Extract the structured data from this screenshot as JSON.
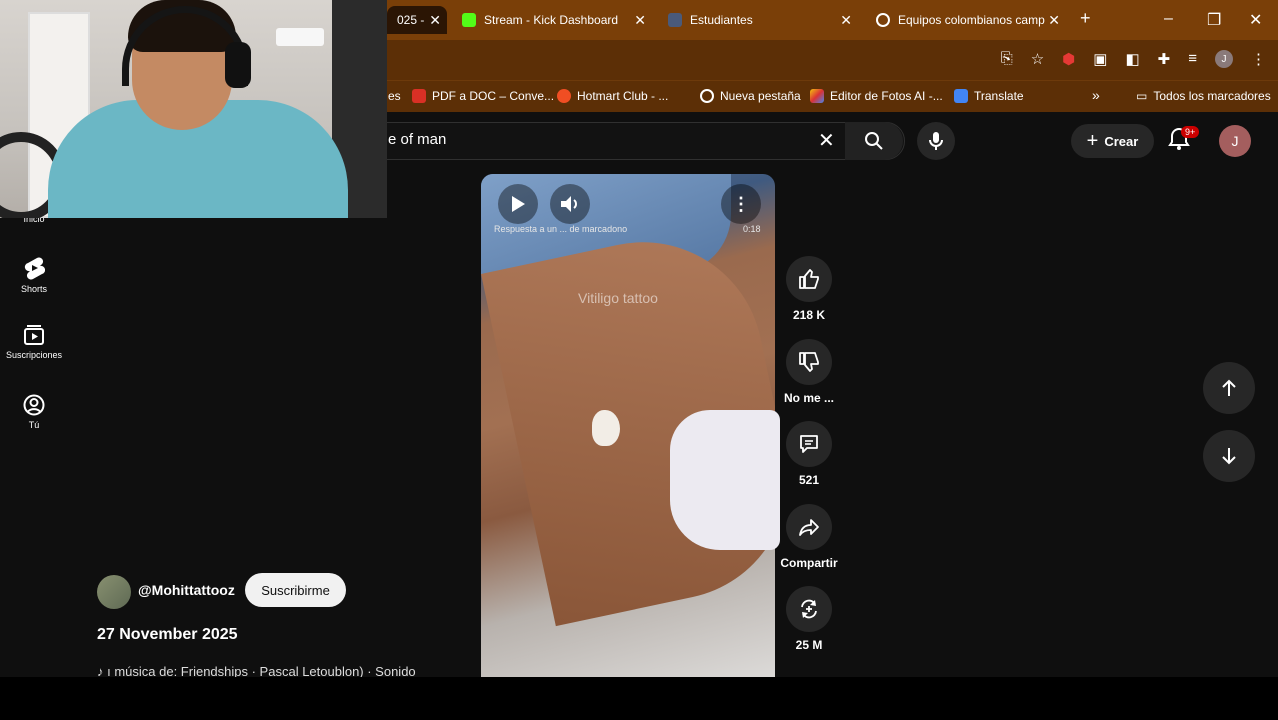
{
  "browser": {
    "tabs": [
      {
        "title": "025 -",
        "active": true
      },
      {
        "title": "Stream - Kick Dashboard",
        "active": false
      },
      {
        "title": "Estudiantes",
        "active": false
      },
      {
        "title": "Equipos colombianos camp",
        "active": false
      }
    ],
    "new_tab": "+",
    "bookmarks": [
      "es",
      "PDF a DOC – Conve...",
      "Hotmart Club - ...",
      "Nueva pestaña",
      "Editor de Fotos AI -...",
      "Translate"
    ],
    "bookmarks_overflow": "»",
    "all_bookmarks": "Todos los marcadores",
    "profile_initial": "J"
  },
  "youtube": {
    "search_value": "e of man",
    "create_label": "Crear",
    "notifications_badge": "9+",
    "avatar_initial": "J",
    "nav": [
      {
        "label": "Inicio",
        "icon": "home-icon"
      },
      {
        "label": "Shorts",
        "icon": "shorts-icon"
      },
      {
        "label": "Suscripciones",
        "icon": "subscriptions-icon"
      },
      {
        "label": "Tú",
        "icon": "you-icon"
      }
    ]
  },
  "short": {
    "caption": "Respuesta a un ... de marcadono",
    "time": "0:18",
    "watermark": "Vitiligo tattoo",
    "likes": "218 K",
    "dislike_label": "No me ...",
    "comments": "521",
    "share_label": "Compartir",
    "remix": "25 M",
    "channel": "@Mohittattooz",
    "subscribe_label": "Suscribirme",
    "date": "27 November 2025",
    "music": "♪ ı música de: Friendships · Pascal Letoublon) · Sonido"
  },
  "colors": {
    "chrome_tabbar": "#7a3f08",
    "chrome_toolbar": "#5c2f06",
    "yt_bg": "#0f0f0f",
    "button_bg": "#272727",
    "badge": "#cc0000"
  }
}
